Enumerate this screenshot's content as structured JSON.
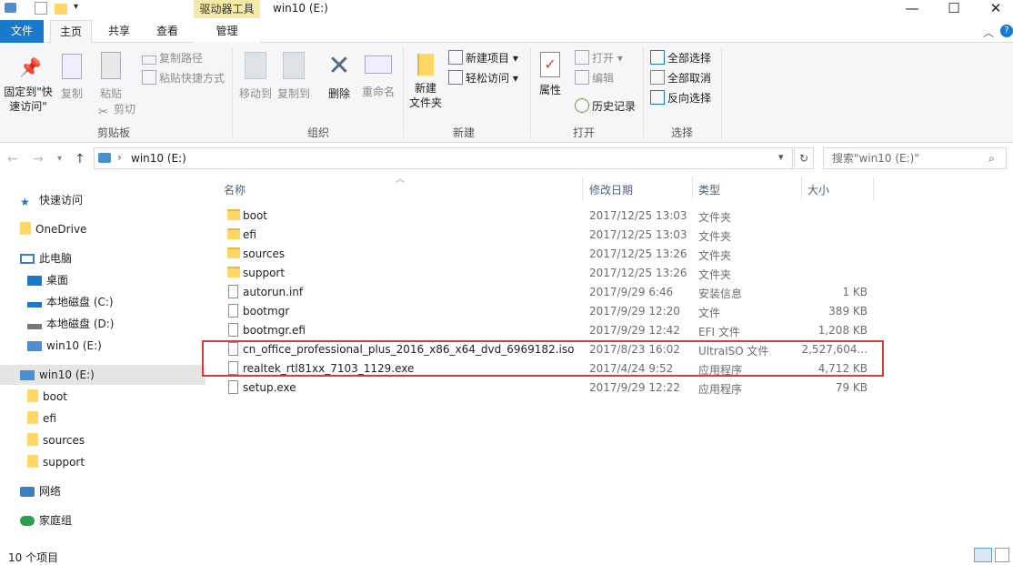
{
  "window": {
    "title": "win10 (E:)",
    "context_tab_label": "驱动器工具",
    "controls": {
      "minimize": "—",
      "maximize": "☐",
      "close": "✕"
    }
  },
  "tabs": [
    {
      "label": "文件"
    },
    {
      "label": "主页"
    },
    {
      "label": "共享"
    },
    {
      "label": "查看"
    },
    {
      "label": "管理"
    }
  ],
  "ribbon": {
    "clipboard": {
      "pin_label": "固定到\"快速访问\"",
      "copy_label": "复制",
      "paste_label": "粘贴",
      "copy_path_label": "复制路径",
      "paste_shortcut_label": "粘贴快捷方式",
      "cut_label": "剪切",
      "group_label": "剪贴板"
    },
    "organize": {
      "move_to_label": "移动到",
      "copy_to_label": "复制到",
      "delete_label": "删除",
      "rename_label": "重命名",
      "group_label": "组织"
    },
    "new": {
      "new_folder_label": "新建\n文件夹",
      "new_item_label": "新建项目",
      "easy_access_label": "轻松访问",
      "group_label": "新建"
    },
    "open": {
      "properties_label": "属性",
      "open_label": "打开",
      "edit_label": "编辑",
      "history_label": "历史记录",
      "group_label": "打开"
    },
    "select": {
      "select_all_label": "全部选择",
      "select_none_label": "全部取消",
      "invert_label": "反向选择",
      "group_label": "选择"
    }
  },
  "address": {
    "path": "win10 (E:)",
    "search_placeholder": "搜索\"win10 (E:)\""
  },
  "nav": {
    "items": [
      {
        "label": "快速访问"
      },
      {
        "label": "OneDrive"
      },
      {
        "label": "此电脑"
      },
      {
        "label": "桌面"
      },
      {
        "label": "本地磁盘 (C:)"
      },
      {
        "label": "本地磁盘 (D:)"
      },
      {
        "label": "win10 (E:)"
      },
      {
        "label": "win10 (E:)"
      },
      {
        "label": "boot"
      },
      {
        "label": "efi"
      },
      {
        "label": "sources"
      },
      {
        "label": "support"
      },
      {
        "label": "网络"
      },
      {
        "label": "家庭组"
      }
    ]
  },
  "columns": {
    "name": "名称",
    "date": "修改日期",
    "type": "类型",
    "size": "大小"
  },
  "files": [
    {
      "name": "boot",
      "date": "2017/12/25 13:03",
      "type": "文件夹",
      "size": "",
      "kind": "folder"
    },
    {
      "name": "efi",
      "date": "2017/12/25 13:03",
      "type": "文件夹",
      "size": "",
      "kind": "folder"
    },
    {
      "name": "sources",
      "date": "2017/12/25 13:26",
      "type": "文件夹",
      "size": "",
      "kind": "folder"
    },
    {
      "name": "support",
      "date": "2017/12/25 13:26",
      "type": "文件夹",
      "size": "",
      "kind": "folder"
    },
    {
      "name": "autorun.inf",
      "date": "2017/9/29 6:46",
      "type": "安装信息",
      "size": "1 KB",
      "kind": "file"
    },
    {
      "name": "bootmgr",
      "date": "2017/9/29 12:20",
      "type": "文件",
      "size": "389 KB",
      "kind": "file"
    },
    {
      "name": "bootmgr.efi",
      "date": "2017/9/29 12:42",
      "type": "EFI 文件",
      "size": "1,208 KB",
      "kind": "file"
    },
    {
      "name": "cn_office_professional_plus_2016_x86_x64_dvd_6969182.iso",
      "date": "2017/8/23 16:02",
      "type": "UltraISO 文件",
      "size": "2,527,604...",
      "kind": "iso"
    },
    {
      "name": "realtek_rtl81xx_7103_1129.exe",
      "date": "2017/4/24 9:52",
      "type": "应用程序",
      "size": "4,712 KB",
      "kind": "exe"
    },
    {
      "name": "setup.exe",
      "date": "2017/9/29 12:22",
      "type": "应用程序",
      "size": "79 KB",
      "kind": "exe"
    }
  ],
  "status": {
    "item_count": "10 个项目"
  },
  "colors": {
    "file_tab": "#1979ca",
    "context_tab": "#f4e9a6",
    "highlight": "#d83c3c",
    "folder": "#ffd765"
  }
}
